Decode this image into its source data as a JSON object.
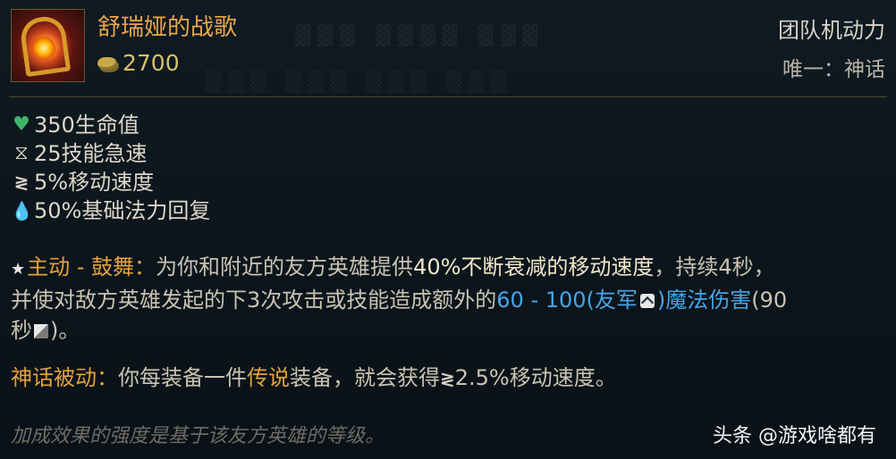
{
  "item": {
    "name": "舒瑞娅的战歌",
    "cost": "2700",
    "category": "团队机动力",
    "unique": "唯一：神话"
  },
  "stats": [
    {
      "icon": "heart-icon",
      "text": "350生命值"
    },
    {
      "icon": "ability-haste-icon",
      "text": "25技能急速"
    },
    {
      "icon": "move-speed-icon",
      "text": "5%移动速度"
    },
    {
      "icon": "mana-regen-icon",
      "text": "50%基础法力回复"
    }
  ],
  "active": {
    "label": "主动 - 鼓舞：",
    "t1": "为你和附近的友方英雄提供",
    "h1": "40%不断衰减的移动速度",
    "t2": "，持续4秒，",
    "t3": "并使对敌方英雄发起的下3次攻击或技能造成额外的",
    "blue1": "60 - 100(友军",
    "blue2": ")魔法伤害",
    "t4": "(90",
    "t5": "秒",
    "t6": ")。"
  },
  "passive": {
    "label": "神话被动：",
    "t1": "你每装备一件",
    "legend": "传说",
    "t2": "装备，就会获得",
    "t3": "2.5%移动速度。"
  },
  "footnote": "加成效果的强度是基于该友方英雄的等级。",
  "watermark": "头条 @游戏啥都有"
}
